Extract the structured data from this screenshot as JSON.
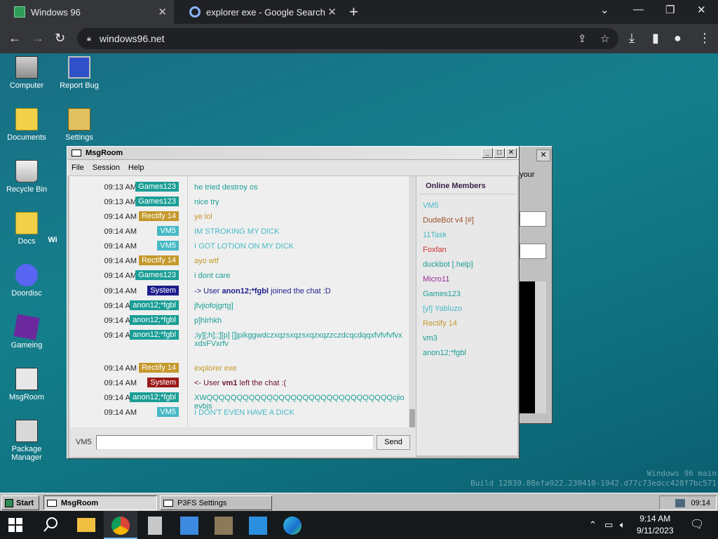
{
  "browser": {
    "tabs": [
      {
        "title": "Windows 96",
        "active": true
      },
      {
        "title": "explorer exe - Google Search",
        "active": false
      }
    ],
    "url": "windows96.net"
  },
  "desktop": {
    "icons": [
      "Computer",
      "Report Bug",
      "Documents",
      "Settings",
      "Recycle Bin",
      "Docs",
      "Doordisc",
      "Gameing",
      "MsgRoom",
      "Package Manager"
    ],
    "partial_icon_label": "Wi",
    "watermark_line1": "Windows 96 main",
    "watermark_line2": "Build 12839.88efa922.230410-1942.d77c73edcc428f7bc571"
  },
  "bg_window": {
    "partial_text": "your"
  },
  "msgroom": {
    "title": "MsgRoom",
    "menu": [
      "File",
      "Session",
      "Help"
    ],
    "messages": [
      {
        "time": "09:13 AM",
        "user": "Games123",
        "user_color": "#1a9e96",
        "text": "he tried destroy os",
        "text_color": "#1a9e96"
      },
      {
        "time": "09:13 AM",
        "user": "Games123",
        "user_color": "#1a9e96",
        "text": "nice try",
        "text_color": "#1a9e96"
      },
      {
        "time": "09:14 AM",
        "user": "Rectify 14",
        "user_color": "#c4982b",
        "text": "ye lol",
        "text_color": "#c4982b"
      },
      {
        "time": "09:14 AM",
        "user": "VM5",
        "user_color": "#46b9c5",
        "text": "IM STROKING MY DICK",
        "text_color": "#46b9c5"
      },
      {
        "time": "09:14 AM",
        "user": "VM5",
        "user_color": "#46b9c5",
        "text": "I GOT LOTION ON MY DICK",
        "text_color": "#46b9c5"
      },
      {
        "time": "09:14 AM",
        "user": "Rectify 14",
        "user_color": "#c4982b",
        "text": "ayo wtf",
        "text_color": "#c4982b"
      },
      {
        "time": "09:14 AM",
        "user": "Games123",
        "user_color": "#1a9e96",
        "text": "i dont care",
        "text_color": "#1a9e96"
      },
      {
        "time": "09:14 AM",
        "user": "System",
        "user_color": "#1c1c8c",
        "text_pre": "-> User ",
        "text_bold": "anon12;*fgbl",
        "text_post": " joined the chat :D",
        "text_color": "#1c1c8c",
        "system": true
      },
      {
        "time": "09:14 AM",
        "user": "anon12;*fgbl",
        "user_color": "#1a9e96",
        "text": "jfvjiofojgrtg]",
        "text_color": "#1a9e96"
      },
      {
        "time": "09:14 AM",
        "user": "anon12;*fgbl",
        "user_color": "#1a9e96",
        "text": "p]hlrhkh",
        "text_color": "#1a9e96"
      },
      {
        "time": "09:14 AM",
        "user": "anon12;*fgbl",
        "user_color": "#1a9e96",
        "text": ";iy][;h];;][p] []jpikggwdczxqzsxqzsxqzxqzzczdcqcdqqxfvfvfvfvxxdxFVxrfv",
        "text_color": "#1a9e96"
      },
      {
        "time": "09:14 AM",
        "user": "Rectify 14",
        "user_color": "#c4982b",
        "text": "explorer exe",
        "text_color": "#c4982b"
      },
      {
        "time": "09:14 AM",
        "user": "System",
        "user_color": "#9b1a1a",
        "text_pre": "<- User ",
        "text_bold": "vm1",
        "text_post": " left the chat :(",
        "text_color": "#6b1030",
        "system": true
      },
      {
        "time": "09:14 AM",
        "user": "anon12;*fgbl",
        "user_color": "#1a9e96",
        "text": "XWQQQQQQQQQQQQQQQQQQQQQQQQQQQQQQQcjioevbjs",
        "text_color": "#1a9e96"
      },
      {
        "time": "09:14 AM",
        "user": "VM5",
        "user_color": "#46b9c5",
        "text": "I DON'T EVEN HAVE A DICK",
        "text_color": "#46b9c5"
      }
    ],
    "members_title": "Online Members",
    "members": [
      {
        "name": "VM5",
        "color": "#46b9c5"
      },
      {
        "name": "DudeBot v4 [#]",
        "color": "#a0522d"
      },
      {
        "name": "11Task",
        "color": "#46b9c5"
      },
      {
        "name": "Foxfan",
        "color": "#d03030"
      },
      {
        "name": "duckbot [.help]",
        "color": "#1a9e96"
      },
      {
        "name": "Micro11",
        "color": "#9b2d9b"
      },
      {
        "name": "Games123",
        "color": "#1a9e96"
      },
      {
        "name": "[yl] Yabluzo",
        "color": "#46b9c5"
      },
      {
        "name": "Rectify 14",
        "color": "#c4982b"
      },
      {
        "name": "vm3",
        "color": "#1a9e96"
      },
      {
        "name": "anon12;*fgbl",
        "color": "#1a9e96"
      }
    ],
    "nick": "VM5",
    "input_value": "",
    "send_label": "Send"
  },
  "w96_taskbar": {
    "start_label": "Start",
    "tasks": [
      "MsgRoom",
      "P3FS Settings"
    ],
    "clock": "09:14"
  },
  "win_taskbar": {
    "time": "9:14 AM",
    "date": "9/11/2023"
  }
}
